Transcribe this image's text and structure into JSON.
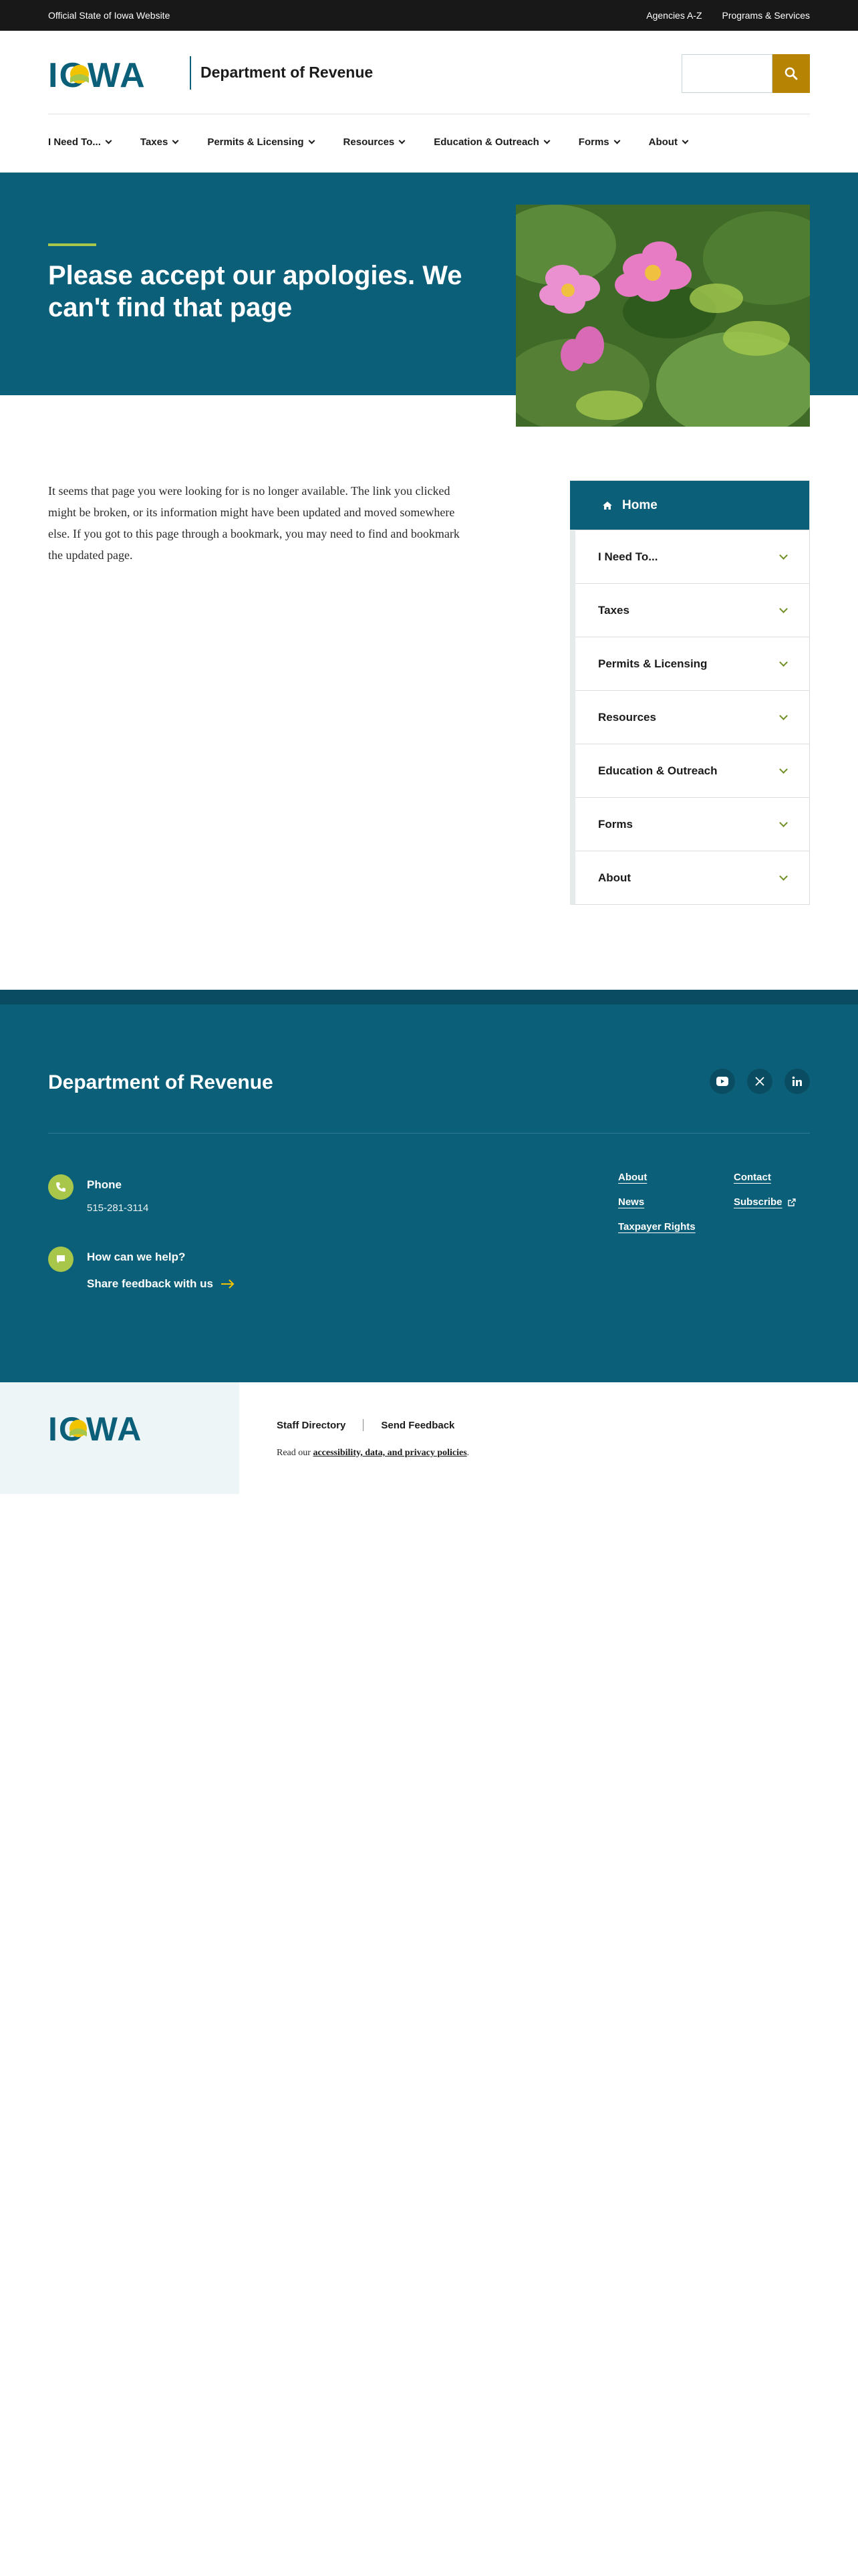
{
  "utility": {
    "official": "Official State of Iowa Website",
    "links": [
      "Agencies A-Z",
      "Programs & Services"
    ]
  },
  "header": {
    "logo_text": "IOWA",
    "department": "Department of Revenue",
    "search_placeholder": ""
  },
  "nav": {
    "items": [
      "I Need To...",
      "Taxes",
      "Permits & Licensing",
      "Resources",
      "Education & Outreach",
      "Forms",
      "About"
    ]
  },
  "hero": {
    "title": "Please accept our apologies. We can't find that page"
  },
  "main": {
    "body": "It seems that page you were looking for is no longer available. The link you clicked might be broken, or its information might have been updated and moved somewhere else. If you got to this page through a bookmark, you may need to find and bookmark the updated page."
  },
  "sidenav": {
    "home": "Home",
    "items": [
      "I Need To...",
      "Taxes",
      "Permits & Licensing",
      "Resources",
      "Education & Outreach",
      "Forms",
      "About"
    ]
  },
  "footer": {
    "title": "Department of Revenue",
    "social": [
      "youtube-icon",
      "x-icon",
      "linkedin-icon"
    ],
    "phone_label": "Phone",
    "phone_value": "515-281-3114",
    "help_label": "How can we help?",
    "feedback_link": "Share feedback with us",
    "col1": [
      "About",
      "News",
      "Taxpayer Rights"
    ],
    "col2": [
      "Contact",
      "Subscribe"
    ]
  },
  "bottom": {
    "logo_text": "IOWA",
    "links": [
      "Staff Directory",
      "Send Feedback"
    ],
    "policy_prefix": "Read our",
    "policy_link": "accessibility, data, and privacy policies",
    "policy_suffix": "."
  },
  "colors": {
    "brand_teal": "#0b5f78",
    "accent_gold": "#b68303",
    "accent_green": "#a7c64a",
    "utility_bg": "#181818"
  }
}
